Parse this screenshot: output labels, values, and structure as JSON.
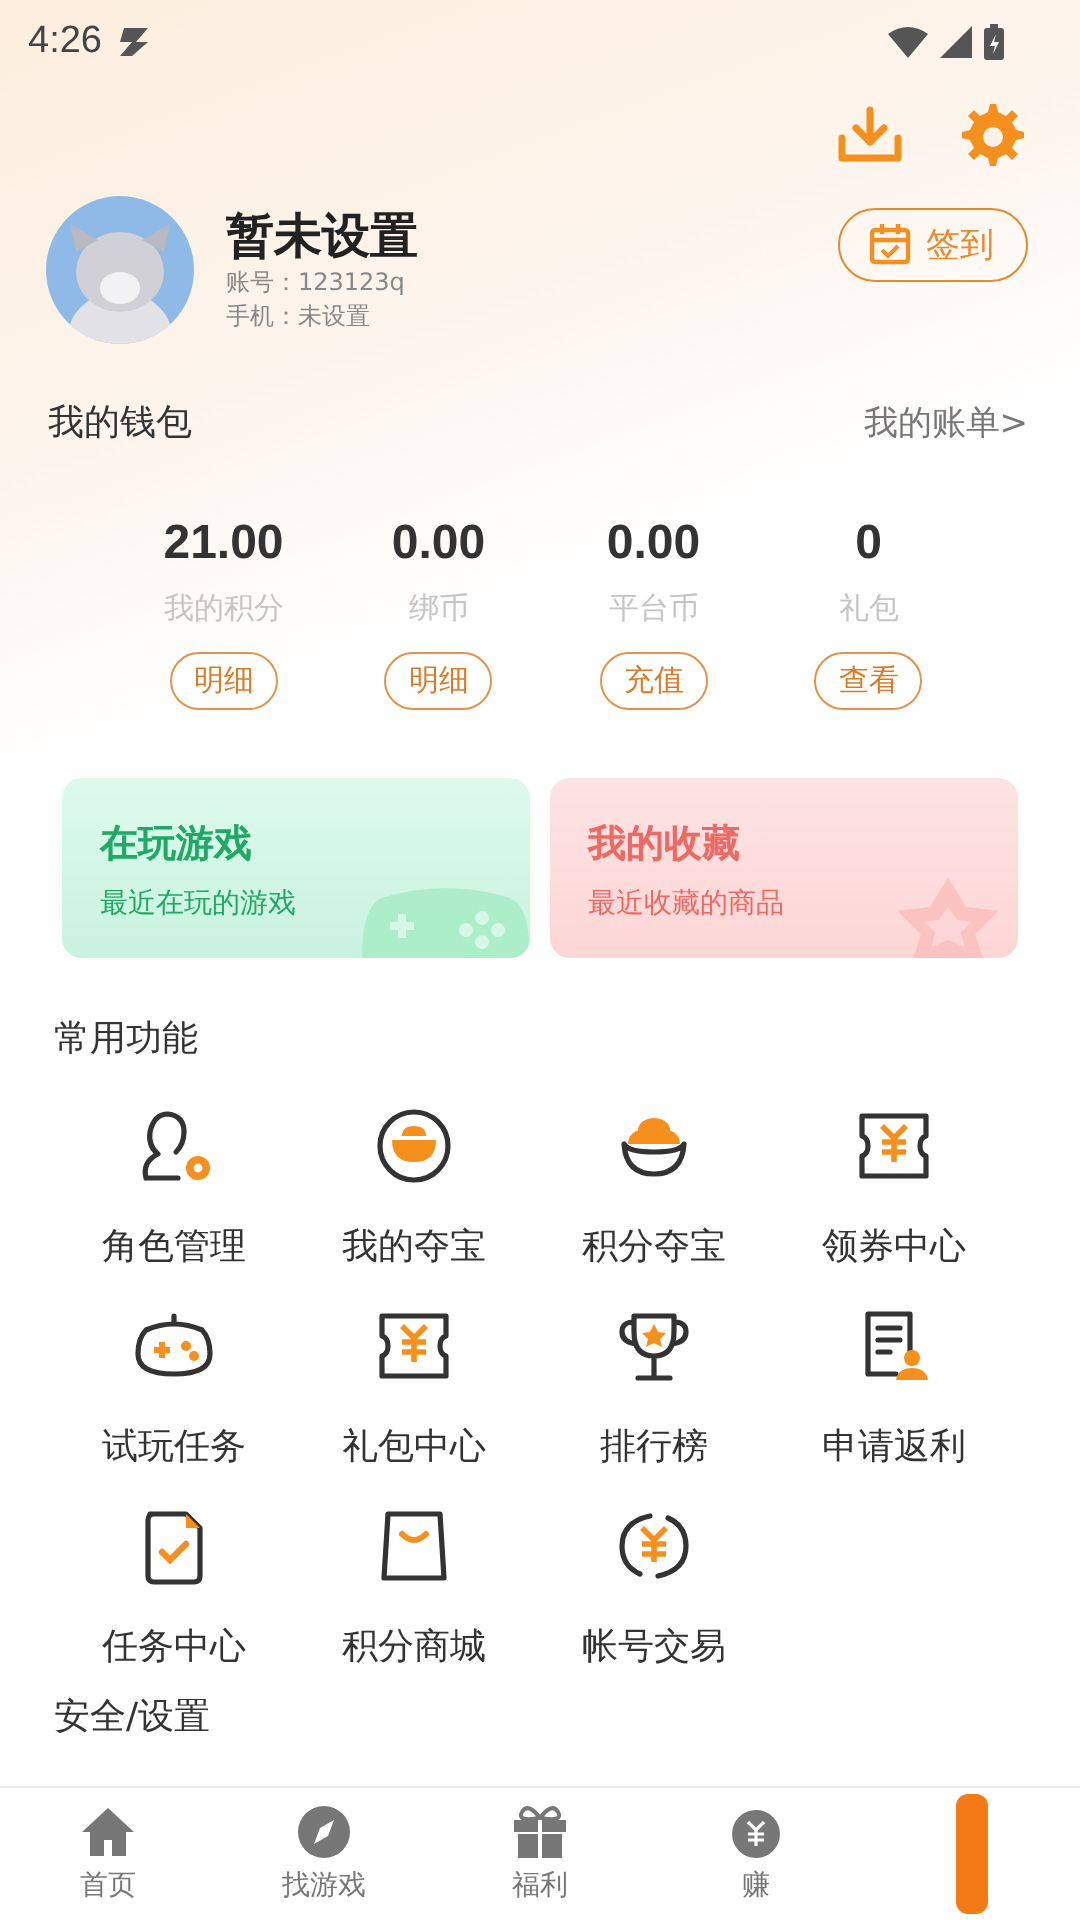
{
  "status_bar": {
    "time": "4:26"
  },
  "profile": {
    "name": "暂未设置",
    "account": "账号：123123q",
    "phone": "手机：未设置",
    "sign_button": "签到"
  },
  "wallet": {
    "title": "我的钱包",
    "bill_link": "我的账单>",
    "stats": [
      {
        "value": "21.00",
        "label": "我的积分",
        "button": "明细"
      },
      {
        "value": "0.00",
        "label": "绑币",
        "button": "明细"
      },
      {
        "value": "0.00",
        "label": "平台币",
        "button": "充值"
      },
      {
        "value": "0",
        "label": "礼包",
        "button": "查看"
      }
    ]
  },
  "cards": [
    {
      "title": "在玩游戏",
      "subtitle": "最近在玩的游戏",
      "color": "#1fa866"
    },
    {
      "title": "我的收藏",
      "subtitle": "最近收藏的商品",
      "color": "#ec6a63"
    }
  ],
  "functions": {
    "title": "常用功能",
    "items": [
      {
        "label": "角色管理"
      },
      {
        "label": "我的夺宝"
      },
      {
        "label": "积分夺宝"
      },
      {
        "label": "领券中心"
      },
      {
        "label": "试玩任务"
      },
      {
        "label": "礼包中心"
      },
      {
        "label": "排行榜"
      },
      {
        "label": "申请返利"
      },
      {
        "label": "任务中心"
      },
      {
        "label": "积分商城"
      },
      {
        "label": "帐号交易"
      }
    ]
  },
  "security": {
    "title": "安全/设置"
  },
  "nav": [
    {
      "label": "首页",
      "selected": false
    },
    {
      "label": "找游戏",
      "selected": false
    },
    {
      "label": "福利",
      "selected": false
    },
    {
      "label": "赚",
      "selected": false
    }
  ]
}
